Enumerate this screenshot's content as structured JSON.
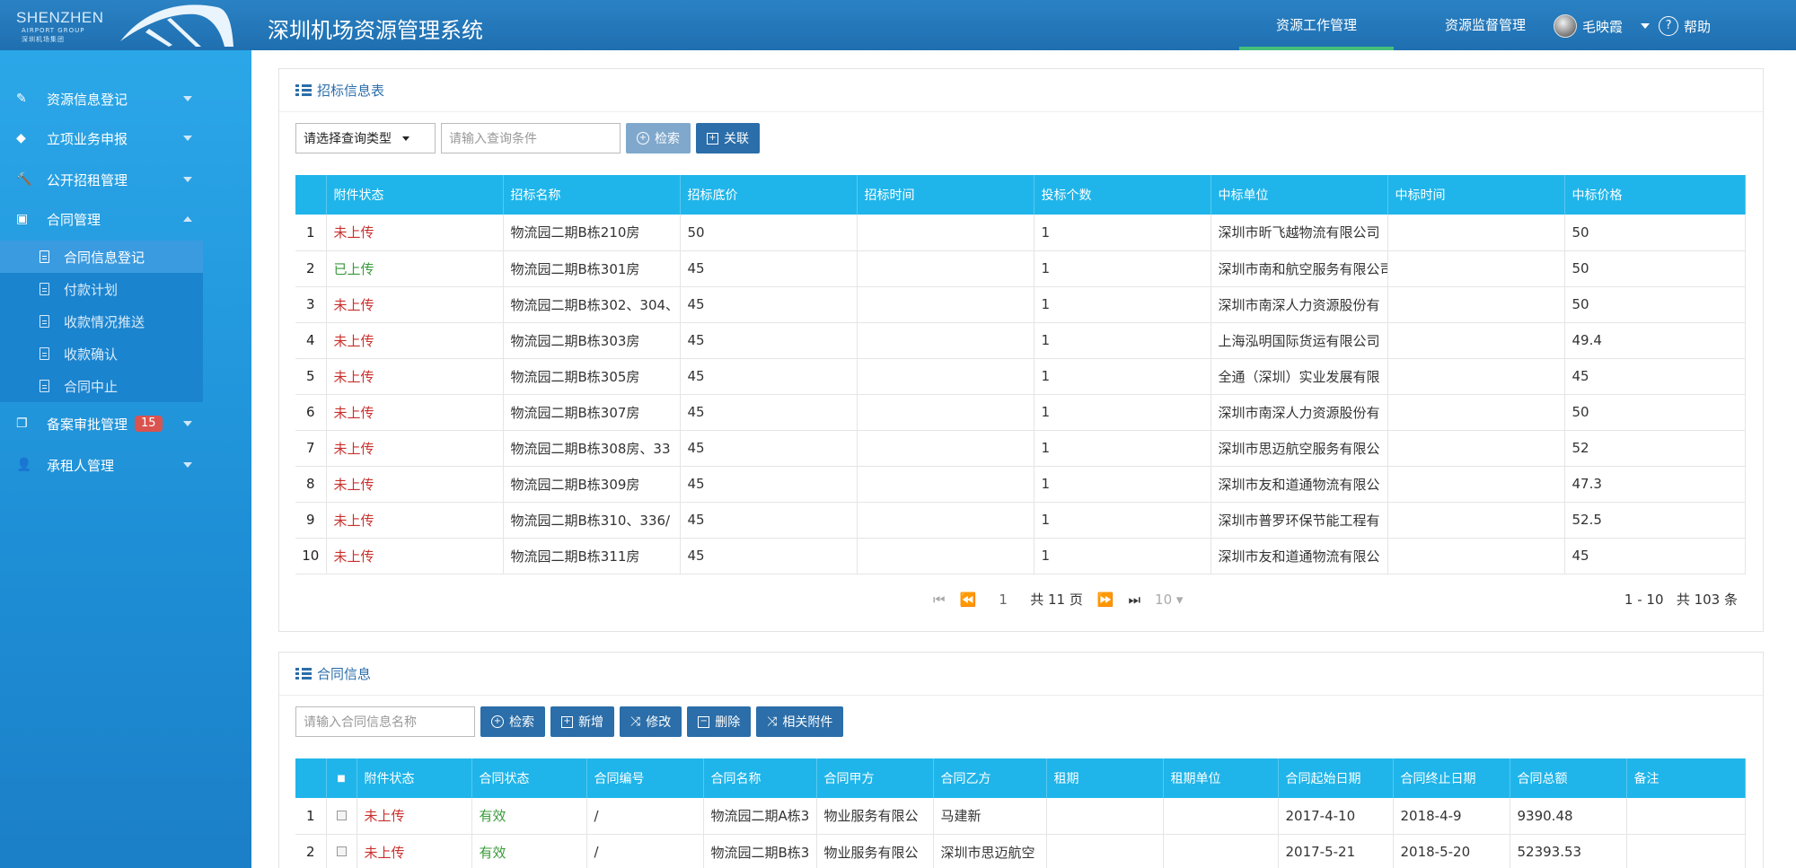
{
  "header": {
    "logo_text": "SHENZHEN",
    "logo_sub": "AIRPORT GROUP",
    "logo_cn": "深圳机场集团",
    "app_title": "深圳机场资源管理系统",
    "tabs": [
      {
        "label": "资源工作管理",
        "active": true
      },
      {
        "label": "资源监督管理",
        "active": false
      }
    ],
    "user_name": "毛映霞",
    "help_label": "帮助"
  },
  "sidebar": {
    "items": [
      {
        "label": "资源信息登记",
        "icon": "edit-icon",
        "expanded": false
      },
      {
        "label": "立项业务申报",
        "icon": "tag-icon",
        "expanded": false
      },
      {
        "label": "公开招租管理",
        "icon": "gavel-icon",
        "expanded": false
      },
      {
        "label": "合同管理",
        "icon": "document-icon",
        "expanded": true
      },
      {
        "label": "备案审批管理",
        "icon": "copy-icon",
        "badge": "15",
        "expanded": false
      },
      {
        "label": "承租人管理",
        "icon": "user-icon",
        "expanded": false
      }
    ],
    "sub_items": [
      {
        "label": "合同信息登记",
        "active": true
      },
      {
        "label": "付款计划",
        "active": false
      },
      {
        "label": "收款情况推送",
        "active": false
      },
      {
        "label": "收款确认",
        "active": false
      },
      {
        "label": "合同中止",
        "active": false
      }
    ]
  },
  "bid_panel": {
    "title": "招标信息表",
    "query_type_select": "请选择查询类型",
    "query_input_placeholder": "请输入查询条件",
    "search_label": "检索",
    "link_label": "关联",
    "columns": [
      "",
      "附件状态",
      "招标名称",
      "招标底价",
      "招标时间",
      "投标个数",
      "中标单位",
      "中标时间",
      "中标价格"
    ],
    "rows": [
      [
        "1",
        "未上传",
        "物流园二期B栋210房",
        "50",
        "",
        "1",
        "深圳市昕飞越物流有限公司",
        "",
        "50"
      ],
      [
        "2",
        "已上传",
        "物流园二期B栋301房",
        "45",
        "",
        "1",
        "深圳市南和航空服务有限公司",
        "",
        "50"
      ],
      [
        "3",
        "未上传",
        "物流园二期B栋302、304、",
        "45",
        "",
        "1",
        "深圳市南深人力资源股份有",
        "",
        "50"
      ],
      [
        "4",
        "未上传",
        "物流园二期B栋303房",
        "45",
        "",
        "1",
        "上海泓明国际货运有限公司",
        "",
        "49.4"
      ],
      [
        "5",
        "未上传",
        "物流园二期B栋305房",
        "45",
        "",
        "1",
        "全通（深圳）实业发展有限",
        "",
        "45"
      ],
      [
        "6",
        "未上传",
        "物流园二期B栋307房",
        "45",
        "",
        "1",
        "深圳市南深人力资源股份有",
        "",
        "50"
      ],
      [
        "7",
        "未上传",
        "物流园二期B栋308房、33",
        "45",
        "",
        "1",
        "深圳市思迈航空服务有限公",
        "",
        "52"
      ],
      [
        "8",
        "未上传",
        "物流园二期B栋309房",
        "45",
        "",
        "1",
        "深圳市友和道通物流有限公",
        "",
        "47.3"
      ],
      [
        "9",
        "未上传",
        "物流园二期B栋310、336/",
        "45",
        "",
        "1",
        "深圳市普罗环保节能工程有",
        "",
        "52.5"
      ],
      [
        "10",
        "未上传",
        "物流园二期B栋311房",
        "45",
        "",
        "1",
        "深圳市友和道通物流有限公",
        "",
        "45"
      ]
    ],
    "pager": {
      "current_page": "1",
      "total_pages": "共 11 页",
      "page_size": "10",
      "range": "1 - 10",
      "total": "共 103 条"
    }
  },
  "contract_panel": {
    "title": "合同信息",
    "search_placeholder": "请输入合同信息名称",
    "buttons": [
      "检索",
      "新增",
      "修改",
      "删除",
      "相关附件"
    ],
    "columns": [
      "",
      "",
      "附件状态",
      "合同状态",
      "合同编号",
      "合同名称",
      "合同甲方",
      "合同乙方",
      "租期",
      "租期单位",
      "合同起始日期",
      "合同终止日期",
      "合同总额",
      "备注"
    ],
    "rows": [
      [
        "1",
        "",
        "未上传",
        "有效",
        "/",
        "物流园二期A栋3",
        "物业服务有限公",
        "马建新",
        "",
        "",
        "2017-4-10",
        "2018-4-9",
        "9390.48",
        ""
      ],
      [
        "2",
        "",
        "未上传",
        "有效",
        "/",
        "物流园二期B栋3",
        "物业服务有限公",
        "深圳市思迈航空",
        "",
        "",
        "2017-5-21",
        "2018-5-20",
        "52393.53",
        ""
      ]
    ]
  },
  "colors": {
    "header_bg": "#1f6fb0",
    "sidebar_bg": "#1e8fd6",
    "table_head": "#1fb5ea",
    "button": "#2b6ea9",
    "status_missing": "#c9302c",
    "status_ok": "#3a9a3a"
  }
}
